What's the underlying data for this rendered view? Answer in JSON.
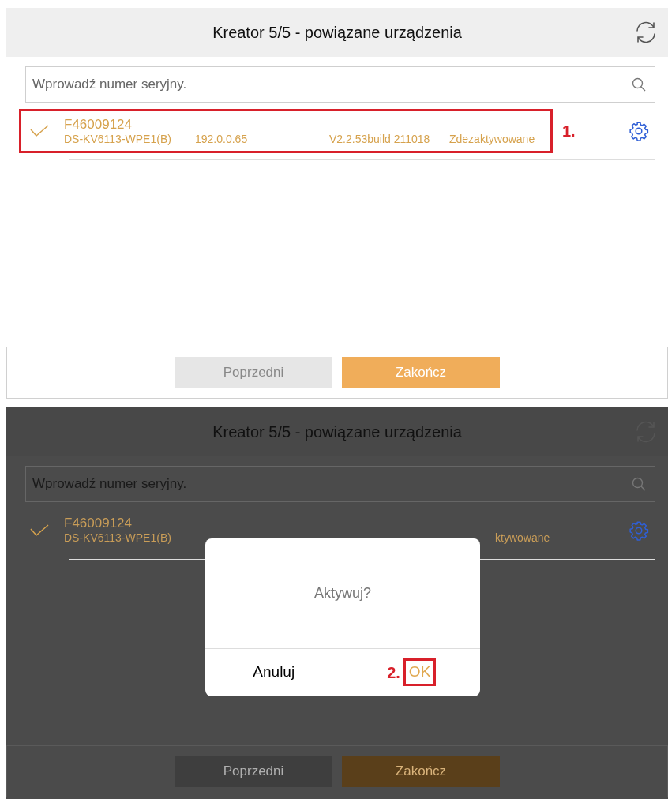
{
  "screens": [
    {
      "title": "Kreator 5/5 - powiązane urządzenia",
      "search": {
        "placeholder": "Wprowadź numer seryjny."
      },
      "devices": [
        {
          "checked": true,
          "serial": "F46009124",
          "model": "DS-KV6113-WPE1(B)",
          "ip": "192.0.0.65",
          "version": "V2.2.53build 211018",
          "status": "Zdezaktywowane",
          "annotation": "1."
        }
      ],
      "buttons": [
        {
          "label": "Poprzedni",
          "kind": "secondary"
        },
        {
          "label": "Zakończ",
          "kind": "primary"
        }
      ]
    },
    {
      "title": "Kreator 5/5 - powiązane urządzenia",
      "search": {
        "placeholder": "Wprowadź numer seryjny."
      },
      "devices": [
        {
          "checked": true,
          "serial": "F46009124",
          "model": "DS-KV6113-WPE1(B)",
          "status": "ktywowane"
        }
      ],
      "buttons": [
        {
          "label": "Poprzedni",
          "kind": "secondary"
        },
        {
          "label": "Zakończ",
          "kind": "primary"
        }
      ],
      "dialog": {
        "message": "Aktywuj?",
        "buttons": [
          {
            "label": "Anuluj",
            "kind": "cancel"
          },
          {
            "label": "OK",
            "kind": "confirm",
            "annotation": "2."
          }
        ]
      }
    }
  ]
}
